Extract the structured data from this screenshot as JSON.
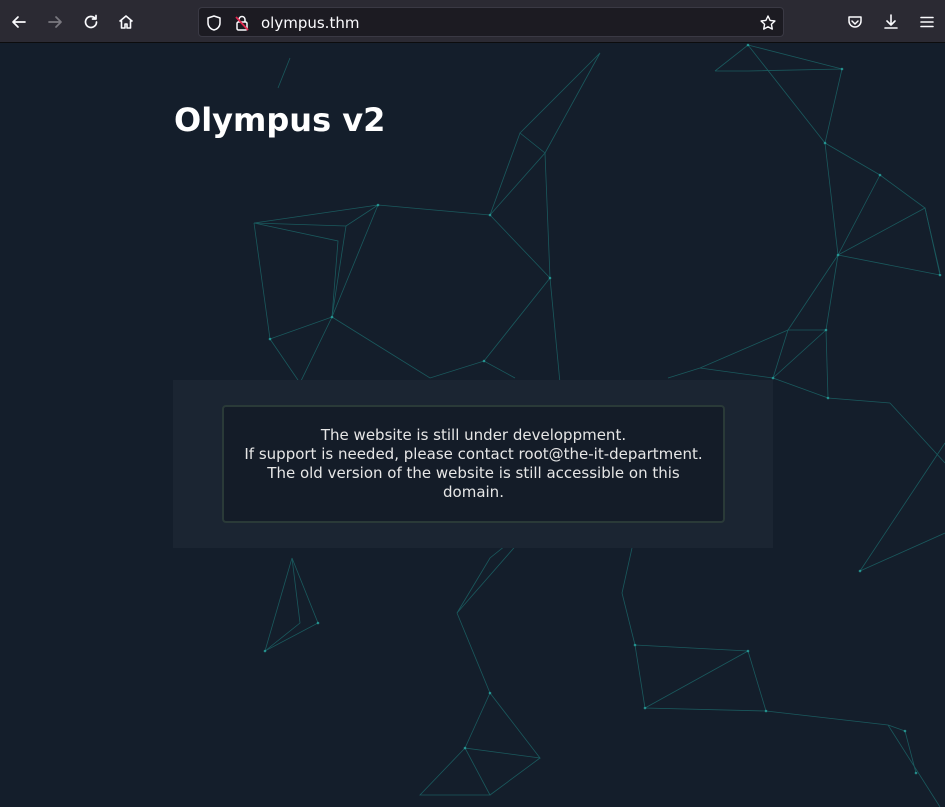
{
  "browser": {
    "url": "olympus.thm",
    "icons": {
      "back": "arrow-left-icon",
      "forward": "arrow-right-icon",
      "reload": "reload-icon",
      "home": "home-icon",
      "shield": "shield-icon",
      "insecure": "insecure-lock-icon",
      "bookmark": "star-icon",
      "pocket": "pocket-icon",
      "downloads": "download-icon",
      "menu": "hamburger-menu-icon"
    }
  },
  "page": {
    "title": "Olympus v2",
    "message": {
      "line1": "The website is still under developpment.",
      "line2": "If support is needed, please contact root@the-it-department.",
      "line3": "The old version of the website is still accessible on this",
      "line4": "domain."
    }
  },
  "colors": {
    "background": "#141e2b",
    "network_lines": "#1f8a87",
    "panel": "#1b2532",
    "toolbar": "#2b2a33"
  }
}
